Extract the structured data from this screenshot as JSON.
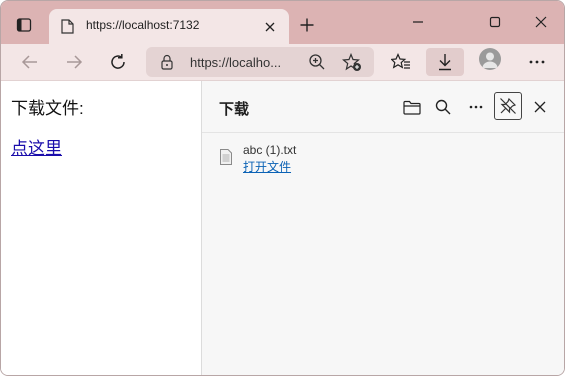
{
  "tab": {
    "title": "https://localhost:7132",
    "favicon": "page-icon"
  },
  "toolbar": {
    "address_text": "https://localho...",
    "icons": [
      "back-arrow-icon",
      "forward-arrow-icon",
      "refresh-icon",
      "lock-icon",
      "zoom-icon",
      "add-favorite-icon",
      "favorites-icon",
      "download-icon",
      "profile-icon",
      "more-icon"
    ]
  },
  "page": {
    "heading": "下载文件:",
    "link_text": "点这里"
  },
  "downloads": {
    "title": "下载",
    "items": [
      {
        "file_name": "abc (1).txt",
        "action_label": "打开文件"
      }
    ]
  },
  "colors": {
    "tabstrip": "#dcb3b3",
    "toolbar": "#f3e6e6",
    "link": "#1a0dab",
    "download_link": "#0b62b5"
  }
}
